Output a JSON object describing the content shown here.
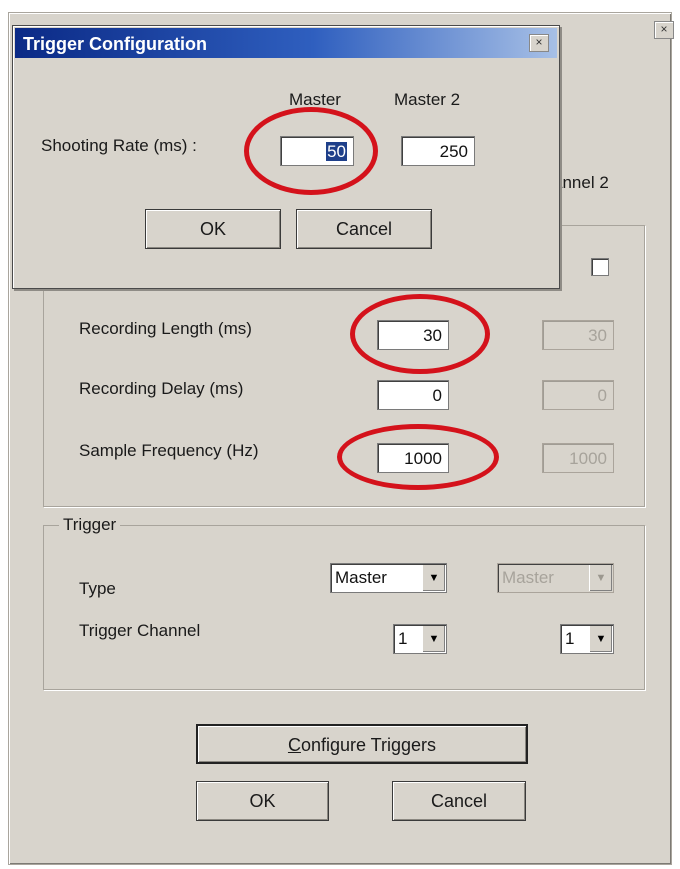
{
  "trigger_dialog": {
    "title": "Trigger Configuration",
    "close_glyph": "×",
    "col_master": "Master",
    "col_master2": "Master 2",
    "shooting_rate_label": "Shooting Rate (ms) :",
    "shooting_rate_master": "50",
    "shooting_rate_master2": "250",
    "ok_label": "OK",
    "cancel_label": "Cancel"
  },
  "main_window": {
    "close_glyph": "×",
    "channel2_partial": "annel 2",
    "recording_length_label": "Recording Length (ms)",
    "recording_length_ch1": "30",
    "recording_length_ch2": "30",
    "recording_delay_label": "Recording Delay (ms)",
    "recording_delay_ch1": "0",
    "recording_delay_ch2": "0",
    "sample_frequency_label": "Sample Frequency (Hz)",
    "sample_frequency_ch1": "1000",
    "sample_frequency_ch2": "1000",
    "trigger_group_title": "Trigger",
    "type_label": "Type",
    "type_ch1": "Master",
    "type_ch2": "Master",
    "trigger_channel_label": "Trigger Channel",
    "trigger_channel_ch1": "1",
    "trigger_channel_ch2": "1",
    "configure_triggers_accel": "C",
    "configure_triggers_rest": "onfigure Triggers",
    "ok_label": "OK",
    "cancel_label": "Cancel"
  },
  "highlight_color": "#d4121b",
  "icons": [
    "close-icon",
    "dropdown-arrow-icon"
  ]
}
